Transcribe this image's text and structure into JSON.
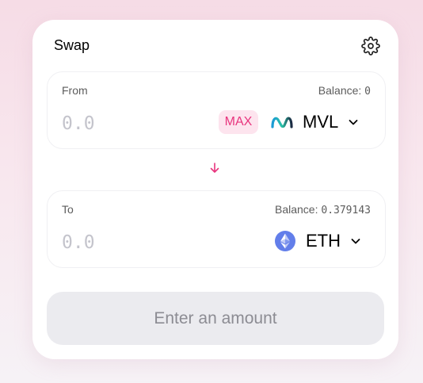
{
  "header": {
    "title": "Swap",
    "settings_icon": "gear-icon"
  },
  "from": {
    "label": "From",
    "balance_label": "Balance: ",
    "balance_value": "0",
    "amount_placeholder": "0.0",
    "max_label": "MAX",
    "token_symbol": "MVL",
    "token_icon": "mvl-token-icon"
  },
  "switch_icon": "arrow-down-icon",
  "to": {
    "label": "To",
    "balance_label": "Balance: ",
    "balance_value": "0.379143",
    "amount_placeholder": "0.0",
    "token_symbol": "ETH",
    "token_icon": "eth-token-icon"
  },
  "action_button": {
    "label": "Enter an amount"
  },
  "colors": {
    "accent": "#e8357e",
    "max_bg": "#fde4ee",
    "button_bg": "#ebebef",
    "button_text": "#8c8c93",
    "eth_blue": "#627eea"
  }
}
